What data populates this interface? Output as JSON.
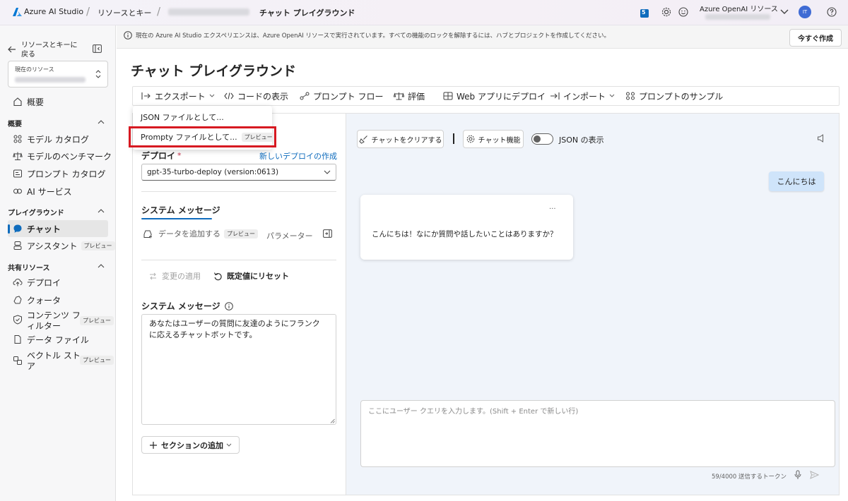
{
  "topbar": {
    "brand": "Azure AI Studio",
    "breadcrumb1": "リソースとキー",
    "breadcrumb3": "チャット プレイグラウンド",
    "notification_count": "5",
    "resource_label": "Azure OpenAI リソース",
    "avatar_initials": "IT"
  },
  "banner": {
    "text": "現在の Azure AI Studio エクスペリエンスは、Azure OpenAI リソースで実行されています。すべての機能のロックを解除するには、ハブとプロジェクトを作成してください。",
    "create_now": "今すぐ作成"
  },
  "leftnav": {
    "back": "リソースとキーに戻る",
    "current_resource_label": "現在のリソース",
    "overview": "概要",
    "section_overview": "概要",
    "model_catalog": "モデル カタログ",
    "model_benchmark": "モデルのベンチマーク",
    "prompt_catalog": "プロンプト カタログ",
    "ai_services": "AI サービス",
    "section_playground": "プレイグラウンド",
    "chat": "チャット",
    "assistant": "アシスタント",
    "preview_badge": "プレビュー",
    "section_shared": "共有リソース",
    "deploy": "デプロイ",
    "quota": "クォータ",
    "content_filter_1": "コンテンツ フ",
    "content_filter_2": "ィルター",
    "data_files": "データ ファイル",
    "vector_store_1": "ベクトル スト",
    "vector_store_2": "ア"
  },
  "main": {
    "title": "チャット プレイグラウンド",
    "toolbar": {
      "export": "エクスポート",
      "show_code": "コードの表示",
      "prompt_flow": "プロンプト フロー",
      "evaluate": "評価",
      "deploy_web": "Web アプリにデプロイ",
      "import": "インポート",
      "prompt_samples": "プロンプトのサンプル"
    },
    "dropdown": {
      "json_file": "JSON ファイルとして...",
      "prompty_file": "Prompty ファイルとして...",
      "preview_badge": "プレビュー"
    },
    "setup": {
      "deploy_label": "デプロイ",
      "required_mark": "*",
      "new_deploy_link": "新しいデプロイの作成",
      "deploy_value": "gpt-35-turbo-deploy (version:0613)",
      "tab_system_message": "システム メッセージ",
      "add_data": "データを追加する",
      "add_data_badge": "プレビュー",
      "parameters": "パラメーター",
      "apply_changes": "変更の適用",
      "reset_default": "既定値にリセット",
      "system_message_label": "システム メッセージ",
      "system_message_text": "あなたはユーザーの質問に友達のようにフランクに応えるチャットボットです。",
      "add_section": "セクションの追加"
    },
    "chat": {
      "clear_chat": "チャットをクリアする",
      "chat_features": "チャット機能",
      "json_toggle": "JSON の表示",
      "json_toggle_on": false,
      "user_message": "こんにちは",
      "assistant_message": "こんにちは！なにか質問や話したいことはありますか？",
      "more": "...",
      "input_placeholder": "ここにユーザー クエリを入力します。(Shift + Enter で新しい行)",
      "token_count": "59/4000 送信するトークン"
    }
  },
  "colors": {
    "accent": "#0f6cbd",
    "highlight": "#d71921",
    "chat_bg": "#f0f4fa",
    "user_bubble": "#cfe4fa"
  }
}
